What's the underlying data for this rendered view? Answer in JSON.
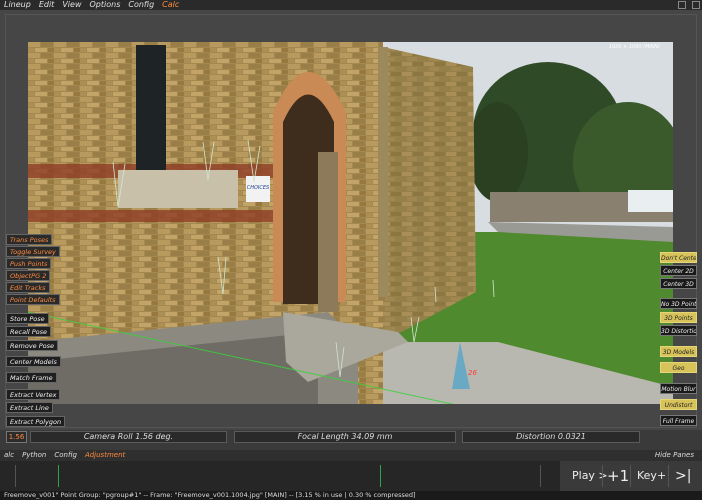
{
  "menubar": {
    "items": [
      "Lineup",
      "Edit",
      "View",
      "Options",
      "Config",
      "Calc"
    ],
    "active_index": 5
  },
  "left_panel": {
    "orange": [
      "Trans Poses",
      "Toggle Survey",
      "Push Points",
      "ObjectPG 2",
      "Edit Tracks",
      "Point Defaults"
    ],
    "white": [
      "Store Pose",
      "Recall Pose",
      "Remove Pose",
      "Center Models",
      "Match Frame",
      "Extract Vertex",
      "Extract Line",
      "Extract Polygon"
    ]
  },
  "right_panel": [
    {
      "label": "Don't Center",
      "style": "yellow"
    },
    {
      "label": "Center 2D",
      "style": "dark"
    },
    {
      "label": "Center 3D",
      "style": "dark"
    },
    {
      "label": "No 3D Points",
      "style": "dark"
    },
    {
      "label": "3D Points",
      "style": "yellow"
    },
    {
      "label": "3D Distortion",
      "style": "dark"
    },
    {
      "label": "3D Models",
      "style": "yellow"
    },
    {
      "label": "Geo",
      "style": "yellow"
    },
    {
      "label": "Motion Blur",
      "style": "dark"
    },
    {
      "label": "Undistort",
      "style": "yellow"
    },
    {
      "label": "Full Frame",
      "style": "dark"
    }
  ],
  "scene": {
    "sign_text": "CHOICES",
    "marker_text": "26",
    "overlay_text": "1920 × 1080 (MAIN)"
  },
  "sliders": {
    "frame": "1.56",
    "camera_roll": "Camera Roll 1.56 deg.",
    "focal_length": "Focal Length 34.09 mm",
    "distortion": "Distortion 0.0321"
  },
  "bottom_menu": {
    "items": [
      "alc",
      "Python",
      "Config",
      "Adjustment"
    ],
    "active_index": 3,
    "hide_panes": "Hide Panes"
  },
  "transport": {
    "play": "Play >",
    "plus_one": "+1",
    "key_plus": "Key+",
    "end": ">|"
  },
  "status": "Freemove_v001\" Point Group: \"pgroup#1\" -- Frame: \"Freemove_v001.1004.jpg\" [MAIN] -- [3.15 % in use | 0.30 % compressed]",
  "colors": {
    "accent": "#ff8a3d",
    "toggle_on": "#d8c35a",
    "track_line": "#3bd13b"
  }
}
